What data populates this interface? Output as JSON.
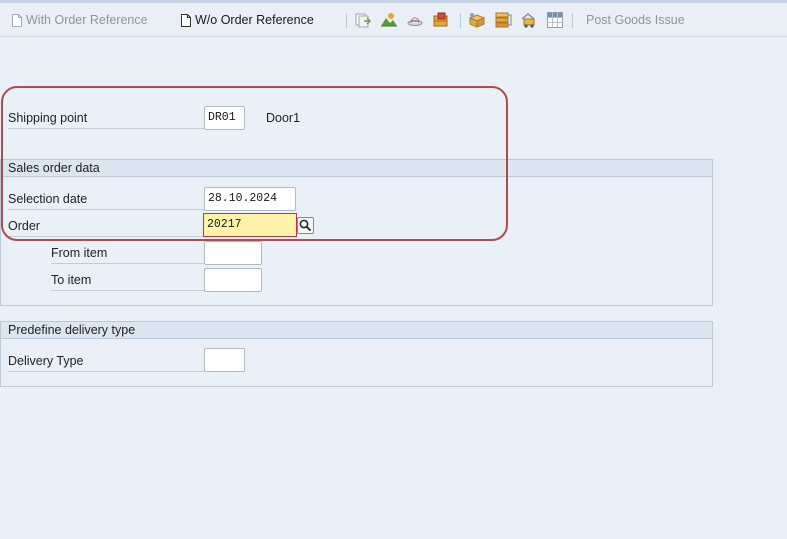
{
  "toolbar": {
    "with_order_ref": "With Order Reference",
    "wo_order_ref": "W/o Order Reference",
    "post_goods_issue": "Post Goods Issue"
  },
  "header": {
    "shipping_point_label": "Shipping point",
    "shipping_point_value": "DR01",
    "shipping_point_desc": "Door1"
  },
  "sales_order_data": {
    "title": "Sales order data",
    "selection_date_label": "Selection date",
    "selection_date_value": "28.10.2024",
    "order_label": "Order",
    "order_value": "20217",
    "from_item_label": "From item",
    "from_item_value": "",
    "to_item_label": "To item",
    "to_item_value": ""
  },
  "delivery_type": {
    "title": "Predefine delivery type",
    "label": "Delivery Type",
    "value": ""
  },
  "colors": {
    "background": "#e9f0f7",
    "active_field": "#fdf3a8",
    "active_border": "#c9323a",
    "highlight": "#b24a50"
  }
}
